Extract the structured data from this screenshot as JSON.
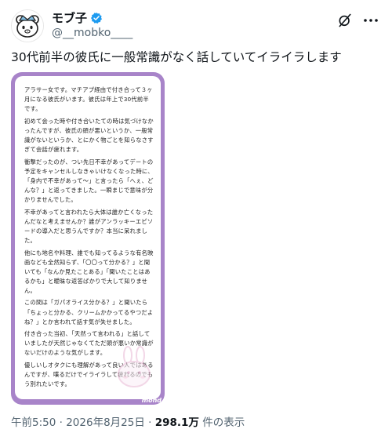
{
  "author": {
    "display_name": "モブ子",
    "handle": "@__mobko____",
    "verified": true,
    "avatar_icon": "bear-face-avatar"
  },
  "header_icons": [
    "grok-icon",
    "more-icon"
  ],
  "tweet": {
    "text": "30代前半の彼氏に一般常識がなく話していてイライラします"
  },
  "image": {
    "paragraphs": [
      "アラサー女です。マチアプ経由で付き合って３ヶ月になる彼氏がいます。彼氏は年上で30代前半です。",
      "初めて会った時や付き合いたての時は気づけなかったんですが、彼氏の頭が悪いというか、一般常識がないというか、とにかく物ごとを知らなさすぎて会話が疲れます。",
      "衝撃だったのが、つい先日不幸があってデートの予定をキャンセルしなきゃいけなくなった時に、「身内で不幸があって〜」と言ったら「へぇ、どんな？」と返ってきました。一瞬まじで意味が分かりませんでした。",
      "不幸があってと言われたら大体は誰か亡くなったんだなと考えませんか？誰がアンラッキーエピソードの導入だと思うんですか？本当に呆れました。",
      "他にも地名や料理、誰でも知ってるような有名映画なども全然知らず、「〇〇って分かる？」と聞いても「なんか見たことある」「聞いたことはあるかも」と曖昧な返答ばかりで大して知りません。",
      "この間は「ガパオライス分かる？」と聞いたら「ちょっと分かる、クリームかかってるやつだよね？」とか言われて話す気が失せました。",
      "付き合った当初、「天然って言われる」と話していましたが天然じゃなくてただ頭が悪いか常識がないだけのような気がします。",
      "優しいしオタクにも理解があって良い人ではあるんですが、喋るだけでイライラして疲れるのでもう別れたいです。"
    ],
    "watermark": "mond"
  },
  "meta": {
    "time": "午前5:50",
    "separator": "·",
    "date": "2026年8月25日",
    "views_count": "298.1万",
    "views_label": "件の表示"
  },
  "colors": {
    "card_frame": "#a884c9",
    "verified_badge": "#1d9bf0",
    "secondary_text": "#536471"
  }
}
